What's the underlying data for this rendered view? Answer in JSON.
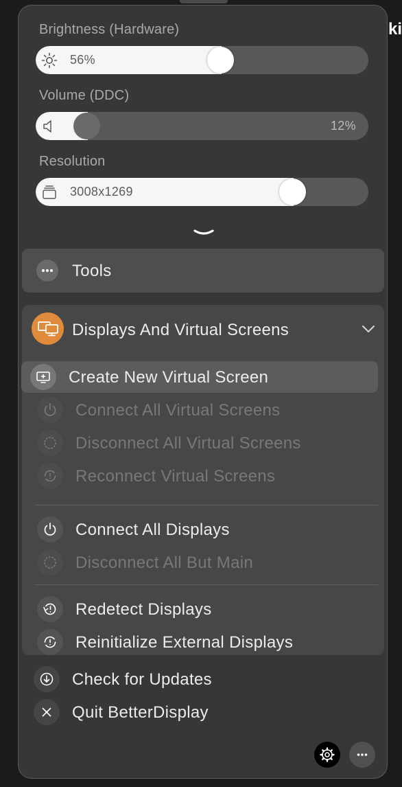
{
  "corner_text": "ki",
  "sliders": {
    "brightness": {
      "label": "Brightness (Hardware)",
      "value_text": "56%",
      "value": 0.56,
      "icon": "sun-icon"
    },
    "volume": {
      "label": "Volume (DDC)",
      "value_text": "12%",
      "value": 0.12,
      "icon": "speaker-icon"
    },
    "resolution": {
      "label": "Resolution",
      "value_text": "3008x1269",
      "value": 0.77,
      "icon": "stack-icon"
    }
  },
  "expand_icon": "chevron-down-icon",
  "tools": {
    "label": "Tools",
    "icon": "ellipsis-icon"
  },
  "displays_section": {
    "label": "Displays And Virtual Screens",
    "icon": "displays-icon",
    "accent": "#e08a3c",
    "items": [
      {
        "label": "Create New Virtual Screen",
        "icon": "add-screen-icon",
        "enabled": true,
        "highlighted": true
      },
      {
        "label": "Connect All Virtual Screens",
        "icon": "power-icon",
        "enabled": false
      },
      {
        "label": "Disconnect All Virtual Screens",
        "icon": "dotted-circle-icon",
        "enabled": false
      },
      {
        "label": "Reconnect Virtual Screens",
        "icon": "refresh-alert-icon",
        "enabled": false
      },
      {
        "label": "Connect All Displays",
        "icon": "power-icon",
        "enabled": true
      },
      {
        "label": "Disconnect All But Main",
        "icon": "dotted-circle-icon",
        "enabled": false
      },
      {
        "label": "Redetect Displays",
        "icon": "redetect-icon",
        "enabled": true
      },
      {
        "label": "Reinitialize External Displays",
        "icon": "reinitialize-icon",
        "enabled": true
      }
    ]
  },
  "bottom_items": [
    {
      "label": "Check for Updates",
      "icon": "download-icon"
    },
    {
      "label": "Quit BetterDisplay",
      "icon": "close-icon"
    }
  ],
  "footer": {
    "settings_icon": "gear-icon",
    "more_icon": "ellipsis-icon"
  }
}
